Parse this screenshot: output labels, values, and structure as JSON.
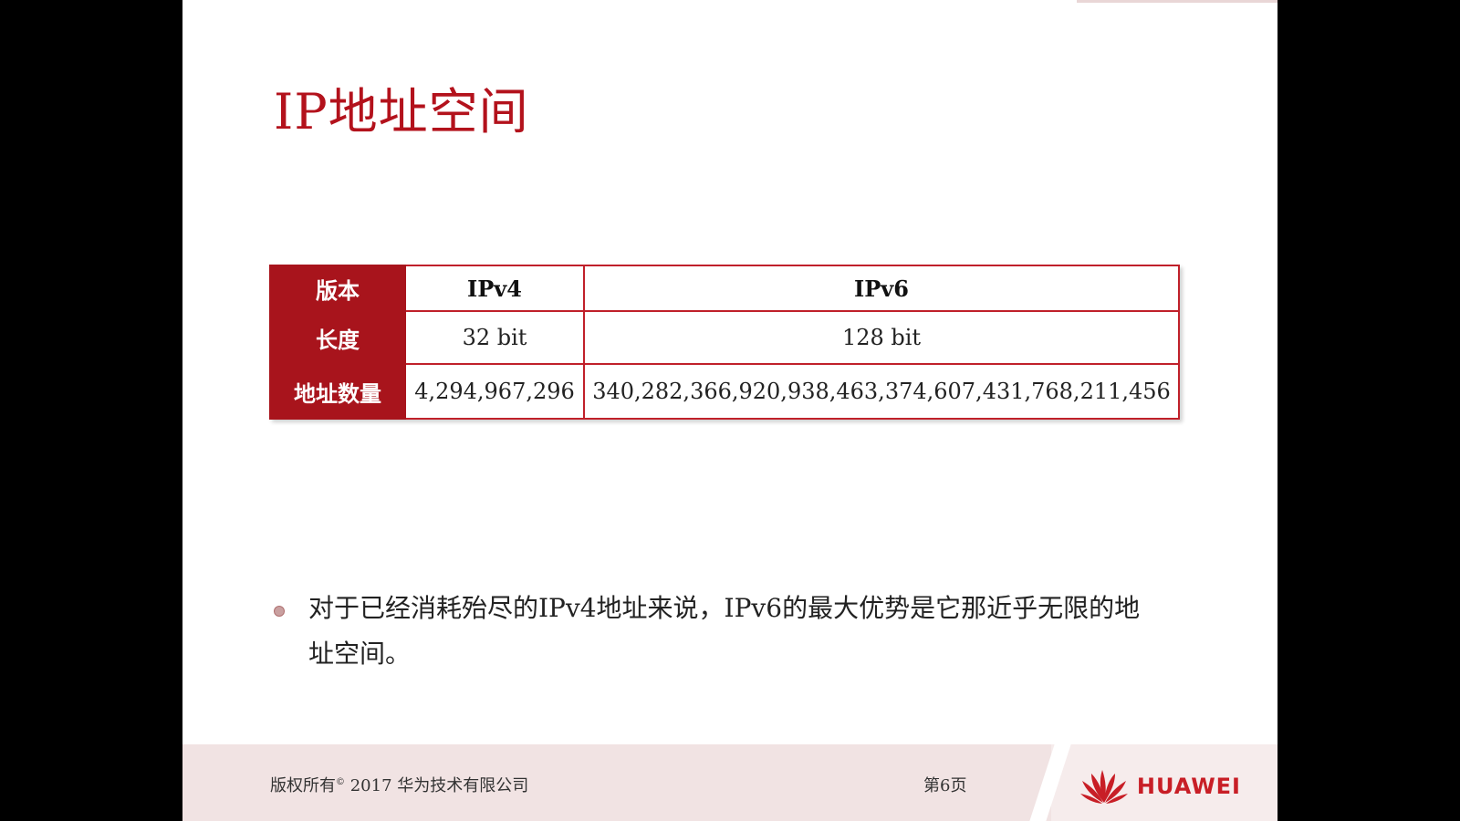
{
  "slide": {
    "title": "IP地址空间",
    "table": {
      "rows": [
        {
          "header": "版本",
          "ipv4": "IPv4",
          "ipv6": "IPv6"
        },
        {
          "header": "长度",
          "ipv4": "32 bit",
          "ipv6": "128 bit"
        },
        {
          "header": "地址数量",
          "ipv4": "4,294,967,296",
          "ipv6": "340,282,366,920,938,463,374,607,431,768,211,456"
        }
      ]
    },
    "bullet": {
      "line1": "对于已经消耗殆尽的IPv4地址来说，IPv6的最大优势是它那近乎无限的地",
      "line2": "址空间。"
    }
  },
  "footer": {
    "copyright_prefix": "版权所有",
    "copyright_symbol": "©",
    "copyright_suffix": " 2017 华为技术有限公司",
    "page": "第6页",
    "brand": "HUAWEI"
  },
  "colors": {
    "title": "#b3121c",
    "header_bg": "#a8141c",
    "border": "#c0202a",
    "brand": "#c81e26"
  }
}
